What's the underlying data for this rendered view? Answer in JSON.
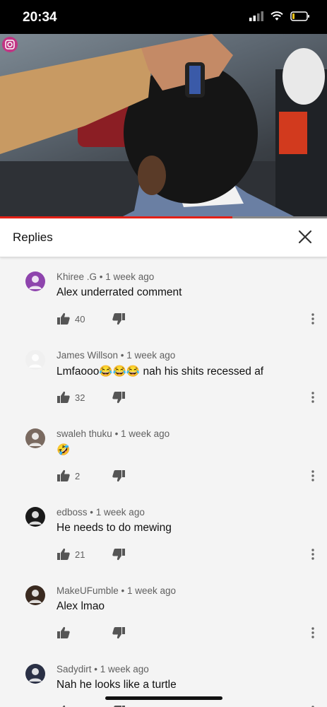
{
  "status_bar": {
    "time": "20:34"
  },
  "video": {
    "progress_fraction": 0.71
  },
  "replies": {
    "title": "Replies"
  },
  "comments": [
    {
      "author": "Khiree .G",
      "age": "1 week ago",
      "text": "Alex underrated comment",
      "likes": "40",
      "avatar_color": "#8e44ad"
    },
    {
      "author": "James Willson",
      "age": "1 week ago",
      "text": "Lmfaooo😂😂😂 nah his shits recessed af",
      "likes": "32",
      "avatar_color": "#f0f0f0"
    },
    {
      "author": "swaleh thuku",
      "age": "1 week ago",
      "text": "🤣",
      "likes": "2",
      "avatar_color": "#7a6a60"
    },
    {
      "author": "edboss",
      "age": "1 week ago",
      "text": "He needs to do mewing",
      "likes": "21",
      "avatar_color": "#1a1a1a"
    },
    {
      "author": "MakeUFumble",
      "age": "1 week ago",
      "text": "Alex lmao",
      "likes": "",
      "avatar_color": "#3a2a20"
    },
    {
      "author": "Sadydirt",
      "age": "1 week ago",
      "text": "Nah he looks like a turtle",
      "likes": "",
      "avatar_color": "#2a3045"
    }
  ]
}
